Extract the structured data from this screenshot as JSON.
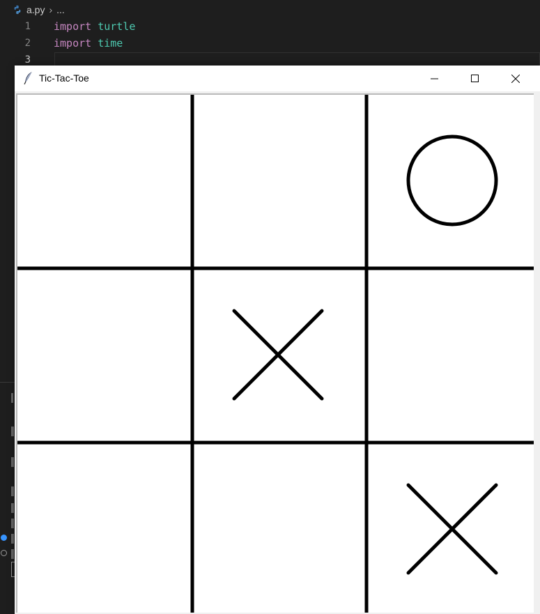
{
  "editor": {
    "breadcrumb_file": "a.py",
    "breadcrumb_sep": "›",
    "breadcrumb_more": "...",
    "lines": [
      {
        "number": "1",
        "keyword": "import",
        "module": "turtle"
      },
      {
        "number": "2",
        "keyword": "import",
        "module": "time"
      },
      {
        "number": "3",
        "keyword": "",
        "module": ""
      }
    ]
  },
  "window": {
    "title": "Tic-Tac-Toe",
    "minimize_label": "Minimize",
    "maximize_label": "Maximize",
    "close_label": "Close"
  },
  "game": {
    "board": [
      [
        "",
        "",
        "O"
      ],
      [
        "",
        "X",
        ""
      ],
      [
        "",
        "",
        "X"
      ]
    ],
    "mark_color": "#000000",
    "background": "#ffffff"
  },
  "colors": {
    "editor_bg": "#1e1e1e",
    "keyword": "#c586c0",
    "module": "#4ec9b0",
    "line_number": "#858585"
  }
}
